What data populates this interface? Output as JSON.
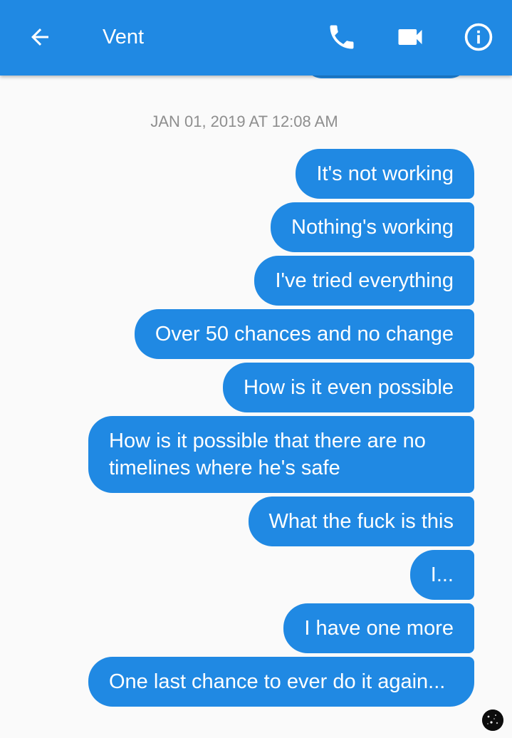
{
  "header": {
    "title": "Vent",
    "icons": {
      "back": "arrow-left-icon",
      "call": "phone-icon",
      "video": "video-camera-icon",
      "info": "info-icon"
    },
    "accent_color": "#2089e3"
  },
  "conversation": {
    "timestamp": "JAN 01, 2019 AT 12:08 AM",
    "messages": [
      {
        "text": "It's not working"
      },
      {
        "text": "Nothing's working"
      },
      {
        "text": "I've tried everything"
      },
      {
        "text": "Over 50 chances and no change"
      },
      {
        "text": "How is it even possible"
      },
      {
        "text": "How is it possible that there are no timelines where he's safe"
      },
      {
        "text": "What the fuck is this"
      },
      {
        "text": "I..."
      },
      {
        "text": "I have one more"
      },
      {
        "text": "One last chance to ever do it again..."
      }
    ]
  }
}
